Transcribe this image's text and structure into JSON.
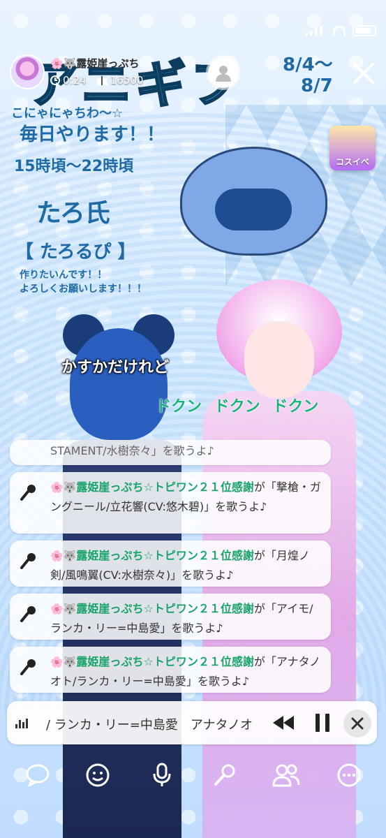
{
  "host": {
    "name": "🌸🐺露姫崖っぷち",
    "duration": "0:24",
    "viewers": "16500"
  },
  "poster": {
    "title": "アニギフ",
    "date": "8/4～\n8/7",
    "greeting": "こにゃにゃちわ〜☆",
    "daily": "毎日やります！！",
    "time": "15時頃～22時頃",
    "creator": "たろ氏",
    "handle": "【 たろるぴ 】",
    "message": "作りたいんです！！\nよろしくお願いします！！！"
  },
  "app_badge": {
    "label": "コスイベ"
  },
  "lyrics": {
    "line_white": "かすかだけれど",
    "line_green": "ドクン ドクン ドクン"
  },
  "song_requests": {
    "partial": "STAMENT/水樹奈々」を歌うよ♪",
    "items": [
      {
        "user": "露姫崖っぷち☆トピワン２１位感謝",
        "pre": "が「",
        "song": "撃槍・ガングニール/立花響(CV:悠木碧)",
        "post": "」を歌うよ♪"
      },
      {
        "user": "露姫崖っぷち☆トピワン２１位感謝",
        "pre": "が「",
        "song": "月煌ノ剣/風鳴翼(CV:水樹奈々)",
        "post": "」を歌うよ♪"
      },
      {
        "user": "露姫崖っぷち☆トピワン２１位感謝",
        "pre": "が「",
        "song": "アイモ/ランカ・リー=中島愛",
        "post": "」を歌うよ♪"
      },
      {
        "user": "露姫崖っぷち☆トピワン２１位感謝",
        "pre": "が「",
        "song": "アナタノオト/ランカ・リー=中島愛",
        "post": "」を歌うよ♪"
      }
    ],
    "emoji_prefix": "🌸🐺"
  },
  "player": {
    "now_playing": "/ ランカ・リー=中島愛　アナタノオ"
  },
  "icons": {
    "comment": "speech-bubble-icon",
    "reaction": "smile-icon",
    "voice": "microphone-icon",
    "karaoke": "karaoke-mic-icon",
    "collab": "people-icon",
    "more": "more-icon"
  }
}
